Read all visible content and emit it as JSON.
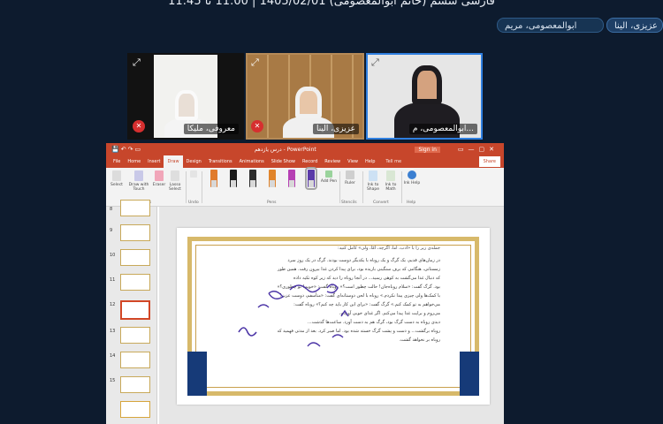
{
  "meeting": {
    "title": "فارسی ششم (خانم ابوالمعصومی) 1405/02/01 | 11:00 تا 11:45"
  },
  "participant_chips": [
    {
      "label": "عزیزی، الینا"
    },
    {
      "label": "ابوالمعصومی، مریم"
    }
  ],
  "video_tiles": [
    {
      "name": "معروفی، ملیکا",
      "mic": "muted"
    },
    {
      "name": "عزیزی، الینا",
      "mic": "muted"
    },
    {
      "name": "ابوالمعصومی، م..."
    }
  ],
  "powerpoint": {
    "doc_title": "درس یازدهم - PowerPoint",
    "signin_label": "Sign in",
    "tabs": [
      "File",
      "Home",
      "Insert",
      "Draw",
      "Design",
      "Transitions",
      "Animations",
      "Slide Show",
      "Record",
      "Review",
      "View",
      "Help"
    ],
    "active_tab": "Draw",
    "tell_me": "Tell me",
    "share_label": "Share",
    "ribbon": {
      "tools": [
        "Select",
        "Draw with Touch",
        "Eraser",
        "Lasso Select"
      ],
      "tools_group": "Tools",
      "undo_group": "Undo",
      "pens_group": "Pens",
      "add_pen": "Add Pen",
      "ruler": "Ruler",
      "stencils_group": "Stencils",
      "ink_to_shape": "Ink to Shape",
      "ink_to_math": "Ink to Math",
      "convert_group": "Convert",
      "ink_help": "Ink Help",
      "help_group": "Help",
      "pen_colors": [
        "#e07b2c",
        "#1a1a1a",
        "#2c2c2c",
        "#e0842b",
        "#b640b4",
        "#5a3aa8"
      ]
    },
    "thumbnails": [
      {
        "number": "8"
      },
      {
        "number": "9"
      },
      {
        "number": "10"
      },
      {
        "number": "11",
        "selected": true
      },
      {
        "number": "12"
      },
      {
        "number": "13"
      },
      {
        "number": "14"
      },
      {
        "number": "15"
      }
    ],
    "slide": {
      "heading": "جمله‌ی زیر را با «ادب، اما، اگرچه، امّا، ولی» کامل کنید:",
      "lines": [
        "در زمان‌های قدیم، یک گرگ و یک روباه با یکدیگر دوست بودند. گرگ در یک روز سرد",
        "زمستانی، هنگامی که برف سنگینی باریده بود، برای پیدا کردن غذا بیرون رفت. همین طور",
        "که دنبال غذا می‌گشت به کوهی رسید... در آنجا روباه را دید که زیر کوه تکیه داده",
        "بود. گرگ گفت: «سلام روباه‌جان! حالت چطور است؟» روباه گفت: «خوبم! تو چطوری؟»",
        "با کمک‌ها ولی چیزی پیدا نکردم.» روباه با لحن دوستانه‌ای گفت: «متأسفم، دوست عزیز!",
        "می‌خواهم به تو کمک کنم.» گرگ گفت: «برای این کار باید چه کنم؟» روباه گفت:",
        "می‌روم و برایت غذا پیدا می‌کنم. اگر غذای خوبی آوردم،",
        "دیدی روباه به دست گرگ بود، گرگ هم به دست آورد. ساعت‌ها گذشت...",
        "روباه برگشت... و دست و پشت گرگ خسته شده بود. اما صبر کرد. بعد از مدتی فهمید که",
        "روباه بر نخواهد گشت."
      ]
    }
  }
}
